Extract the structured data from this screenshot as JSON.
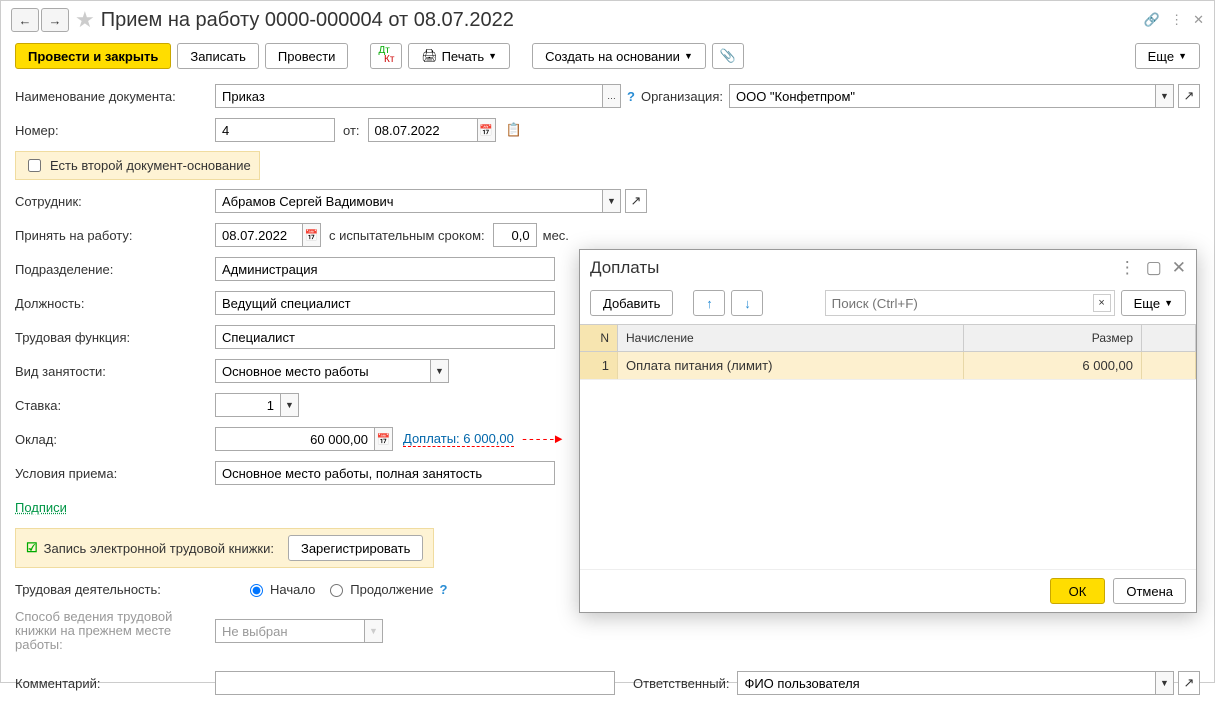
{
  "header": {
    "title": "Прием на работу 0000-000004 от 08.07.2022"
  },
  "toolbar": {
    "post_close": "Провести и закрыть",
    "save": "Записать",
    "post": "Провести",
    "print": "Печать",
    "create_based": "Создать на основании",
    "more": "Еще"
  },
  "labels": {
    "doc_name": "Наименование документа:",
    "org": "Организация:",
    "number": "Номер:",
    "from": "от:",
    "second_doc": "Есть второй документ-основание",
    "employee": "Сотрудник:",
    "hire_date": "Принять на работу:",
    "probation": "с испытательным сроком:",
    "months": "мес.",
    "department": "Подразделение:",
    "position": "Должность:",
    "job_function": "Трудовая функция:",
    "employment_type": "Вид занятости:",
    "rate": "Ставка:",
    "salary": "Оклад:",
    "surcharges": "Доплаты: 6 000,00",
    "conditions": "Условия приема:",
    "signatures": "Подписи",
    "ework_record": "Запись электронной трудовой книжки:",
    "register": "Зарегистрировать",
    "work_activity": "Трудовая деятельность:",
    "start": "Начало",
    "continuation": "Продолжение",
    "prev_method": "Способ ведения трудовой книжки на прежнем месте работы:",
    "not_selected": "Не выбран",
    "comment": "Комментарий:",
    "responsible": "Ответственный:"
  },
  "values": {
    "doc_name": "Приказ",
    "org": "ООО \"Конфетпром\"",
    "number": "4",
    "date": "08.07.2022",
    "employee": "Абрамов Сергей Вадимович",
    "hire_date": "08.07.2022",
    "probation": "0,0",
    "department": "Администрация",
    "position": "Ведущий специалист",
    "job_function": "Специалист",
    "employment_type": "Основное место работы",
    "rate": "1",
    "salary": "60 000,00",
    "conditions": "Основное место работы, полная занятость",
    "responsible": "ФИО пользователя",
    "comment": ""
  },
  "popup": {
    "title": "Доплаты",
    "add": "Добавить",
    "search_ph": "Поиск (Ctrl+F)",
    "more": "Еще",
    "col_n": "N",
    "col_name": "Начисление",
    "col_size": "Размер",
    "row1_n": "1",
    "row1_name": "Оплата питания (лимит)",
    "row1_size": "6 000,00",
    "ok": "ОК",
    "cancel": "Отмена"
  }
}
